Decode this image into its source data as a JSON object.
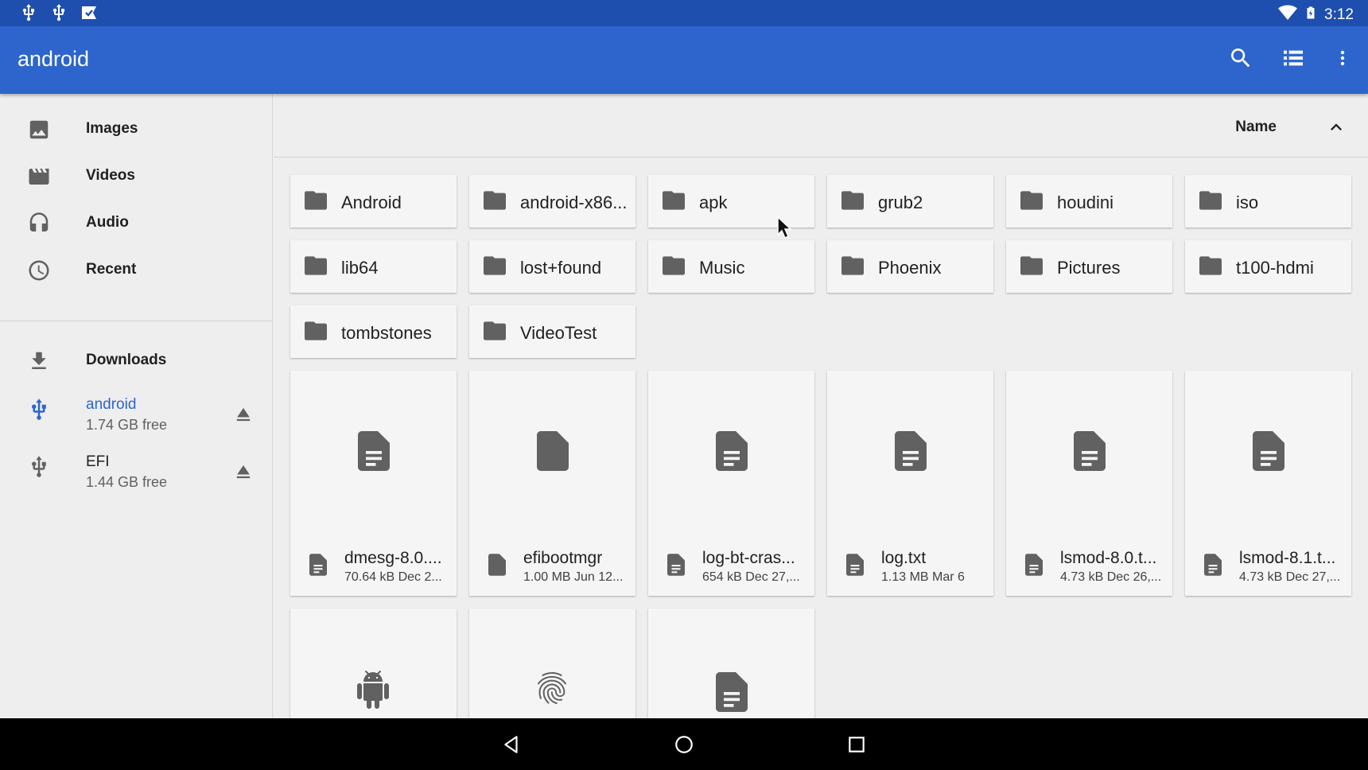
{
  "status_bar": {
    "time": "3:12",
    "left_icons": [
      "usb-icon",
      "usb-icon",
      "debug-check-icon"
    ],
    "right_icons": [
      "wifi-icon",
      "battery-icon"
    ]
  },
  "app_bar": {
    "title": "android",
    "actions": [
      "search-icon",
      "list-view-icon",
      "more-vert-icon"
    ],
    "color": "#2d65cc"
  },
  "sidebar": {
    "items": [
      {
        "label": "Images",
        "icon": "image-icon"
      },
      {
        "label": "Videos",
        "icon": "video-icon"
      },
      {
        "label": "Audio",
        "icon": "headphones-icon"
      },
      {
        "label": "Recent",
        "icon": "clock-icon"
      }
    ],
    "roots": [
      {
        "label": "Downloads",
        "icon": "download-icon"
      },
      {
        "label": "android",
        "sub": "1.74 GB free",
        "icon": "usb-icon",
        "active": true
      },
      {
        "label": "EFI",
        "sub": "1.44 GB free",
        "icon": "usb-icon"
      }
    ],
    "active_color": "#2d65cc"
  },
  "sort": {
    "label": "Name",
    "direction": "ascending"
  },
  "folders": [
    {
      "name": "Android"
    },
    {
      "name": "android-x86..."
    },
    {
      "name": "apk"
    },
    {
      "name": "grub2"
    },
    {
      "name": "houdini"
    },
    {
      "name": "iso"
    },
    {
      "name": "lib64"
    },
    {
      "name": "lost+found"
    },
    {
      "name": "Music"
    },
    {
      "name": "Phoenix"
    },
    {
      "name": "Pictures"
    },
    {
      "name": "t100-hdmi"
    },
    {
      "name": "tombstones"
    },
    {
      "name": "VideoTest"
    }
  ],
  "files": [
    {
      "name": "dmesg-8.0....",
      "meta": "70.64 kB Dec 2...",
      "icon": "text-file-icon"
    },
    {
      "name": "efibootmgr",
      "meta": "1.00 MB Jun 12...",
      "icon": "generic-file-icon"
    },
    {
      "name": "log-bt-cras...",
      "meta": "654 kB Dec 27,...",
      "icon": "text-file-icon"
    },
    {
      "name": "log.txt",
      "meta": "1.13 MB Mar 6",
      "icon": "text-file-icon"
    },
    {
      "name": "lsmod-8.0.t...",
      "meta": "4.73 kB Dec 26,...",
      "icon": "text-file-icon"
    },
    {
      "name": "lsmod-8.1.t...",
      "meta": "4.73 kB Dec 27,...",
      "icon": "text-file-icon"
    },
    {
      "name": "",
      "meta": "",
      "icon": "android-icon"
    },
    {
      "name": "",
      "meta": "",
      "icon": "fingerprint-icon"
    },
    {
      "name": "",
      "meta": "",
      "icon": "text-file-icon"
    }
  ],
  "nav_bar": {
    "buttons": [
      "back-icon",
      "home-icon",
      "recents-icon"
    ]
  }
}
